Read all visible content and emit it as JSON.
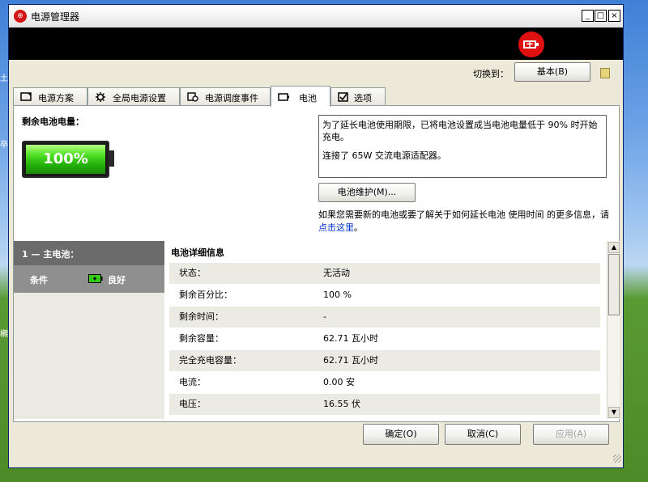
{
  "window": {
    "title": "电源管理器",
    "controls": {
      "minimize": "_",
      "maximize": "□",
      "close": "×"
    }
  },
  "switch": {
    "label": "切换到：",
    "button": "基本(B)"
  },
  "tabs": [
    {
      "label": "电源方案",
      "icon": "monitor-icon"
    },
    {
      "label": "全局电源设置",
      "icon": "gear-icon"
    },
    {
      "label": "电源调度事件",
      "icon": "clock-icon"
    },
    {
      "label": "电池",
      "icon": "battery-icon",
      "active": true
    },
    {
      "label": "选项",
      "icon": "checkbox-icon"
    }
  ],
  "battery_tab": {
    "remaining_label": "剩余电池电量：",
    "percent": "100%",
    "level": 1.0,
    "info_line1": "为了延长电池使用期限，已将电池设置成当电池电量低于 90% 时开始充电。",
    "info_line2": "连接了 65W 交流电源适配器。",
    "maintenance_button": "电池维护(M)...",
    "more_info_text": "如果您需要新的电池或要了解关于如何延长电池 使用时间 的更多信息，请",
    "more_info_link": "点击这里",
    "more_info_end": "。"
  },
  "battery_list": {
    "header": "1 — 主电池：",
    "condition_label": "条件",
    "condition_value": "良好"
  },
  "details": {
    "title": "电池详细信息",
    "rows": [
      {
        "label": "状态：",
        "value": "无活动"
      },
      {
        "label": "剩余百分比：",
        "value": "100 %"
      },
      {
        "label": "剩余时间：",
        "value": "-"
      },
      {
        "label": "剩余容量：",
        "value": "62.71 瓦小时"
      },
      {
        "label": "完全充电容量：",
        "value": "62.71 瓦小时"
      },
      {
        "label": "电流：",
        "value": "0.00 安"
      },
      {
        "label": "电压：",
        "value": "16.55 伏"
      }
    ]
  },
  "footer": {
    "ok": "确定(O)",
    "cancel": "取消(C)",
    "apply": "应用(A)"
  },
  "desktop": {
    "text1": "土",
    "text2": "卒",
    "text3": "櫬"
  },
  "colors": {
    "accent_red": "#e01010",
    "battery_green": "#22b00a",
    "link": "#0033cc"
  }
}
